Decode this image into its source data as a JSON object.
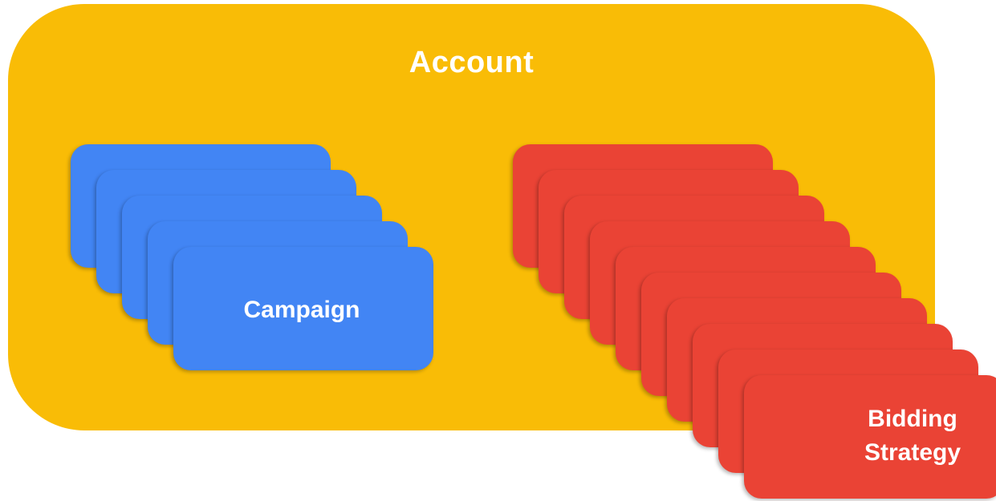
{
  "colors": {
    "account": "#F9BC06",
    "campaign": "#4285F4",
    "bidding_strategy": "#EA4335",
    "label": "#FFFFFF"
  },
  "account": {
    "label": "Account"
  },
  "campaign": {
    "label": "Campaign",
    "stack_count": 5
  },
  "bidding_strategy": {
    "label_line1": "Bidding",
    "label_line2": "Strategy",
    "stack_count": 10
  }
}
